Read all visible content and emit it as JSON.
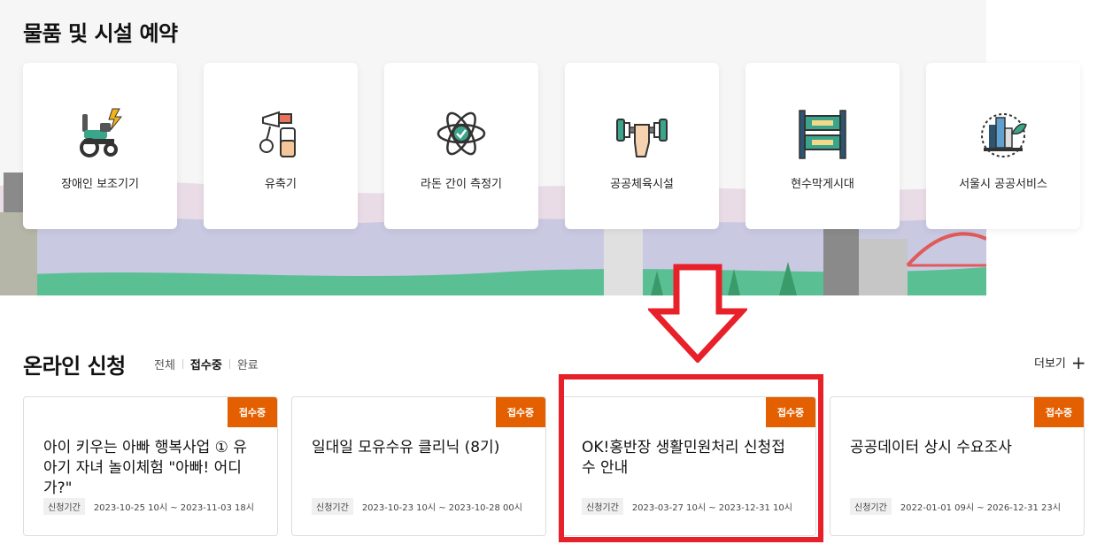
{
  "facilities": {
    "title": "물품 및 시설 예약",
    "items": [
      {
        "label": "장애인 보조기기",
        "icon": "wheelchair-icon"
      },
      {
        "label": "유축기",
        "icon": "breast-pump-icon"
      },
      {
        "label": "라돈 간이 측정기",
        "icon": "atom-icon"
      },
      {
        "label": "공공체육시설",
        "icon": "dumbbell-icon"
      },
      {
        "label": "현수막게시대",
        "icon": "banner-stand-icon"
      },
      {
        "label": "서울시 공공서비스",
        "icon": "city-globe-icon"
      }
    ]
  },
  "online": {
    "title": "온라인 신청",
    "filters": [
      "전체",
      "접수중",
      "완료"
    ],
    "active_filter": "접수중",
    "more_label": "더보기",
    "period_tag": "신청기간",
    "cards": [
      {
        "badge": "접수중",
        "title": "아이 키우는 아빠 행복사업 ① 유아기 자녀 놀이체험 \"아빠! 어디가?\"",
        "period": "2023-10-25 10시 ~ 2023-11-03 18시"
      },
      {
        "badge": "접수중",
        "title": "일대일 모유수유 클리닉 (8기)",
        "period": "2023-10-23 10시 ~ 2023-10-28 00시"
      },
      {
        "badge": "접수중",
        "title": "OK!홍반장 생활민원처리 신청접수 안내",
        "period": "2023-03-27 10시 ~ 2023-12-31 10시"
      },
      {
        "badge": "접수중",
        "title": "공공데이터 상시 수요조사",
        "period": "2022-01-01 09시 ~ 2026-12-31 23시"
      }
    ]
  },
  "colors": {
    "accent": "#e35f00",
    "highlight": "#e8202a"
  }
}
